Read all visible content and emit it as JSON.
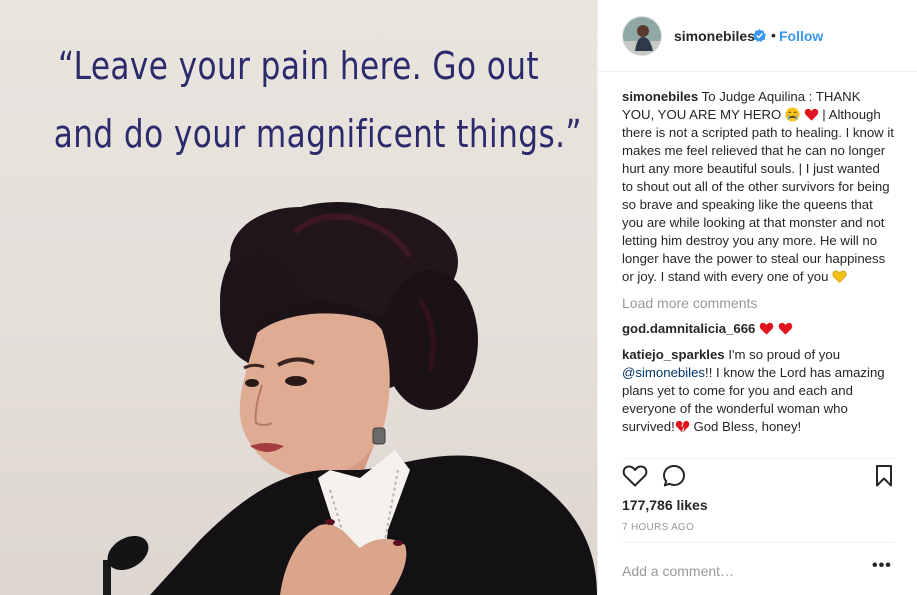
{
  "image": {
    "quote_lines": [
      "“Leave your pain here. Go out",
      "and do your magnificent things.”"
    ]
  },
  "header": {
    "username": "simonebiles",
    "separator": "•",
    "follow_label": "Follow"
  },
  "caption": {
    "username": "simonebiles",
    "text_part1": "To Judge Aquilina : THANK YOU, YOU ARE MY HERO",
    "text_part2": "| Although there is not a scripted path to healing. I know it makes me feel relieved that he can no longer hurt any more beautiful souls. | I just wanted to shout out all of the other survivors for being so brave and speaking like the queens that you are while looking at that monster and not letting him destroy you any more. He will no longer have the power to steal our happiness or joy. I stand with every one of you"
  },
  "load_more_label": "Load more comments",
  "comments": [
    {
      "username": "god.damnitalicia_666"
    },
    {
      "username": "katiejo_sparkles",
      "text_part1": "I'm so proud of you",
      "mention": "@simonebiles",
      "text_part2": "!! I know the Lord has amazing plans yet to come for you and each and everyone of the wonderful woman who survived!",
      "text_part3": "God Bless, honey!"
    }
  ],
  "likes_label": "177,786 likes",
  "timestamp": "7 HOURS AGO",
  "add_comment_placeholder": "Add a comment…",
  "more_options_label": "•••",
  "colors": {
    "quote": "#2b2a6b",
    "link_blue": "#3897f0",
    "heart_red": "#e0131f",
    "heart_yellow": "#f2c01a",
    "muted": "#999999"
  },
  "icons": [
    "verified-badge-icon",
    "heart-outline-icon",
    "comment-bubble-icon",
    "bookmark-icon",
    "crying-face-emoji",
    "red-heart-emoji",
    "yellow-heart-emoji",
    "broken-heart-emoji"
  ]
}
